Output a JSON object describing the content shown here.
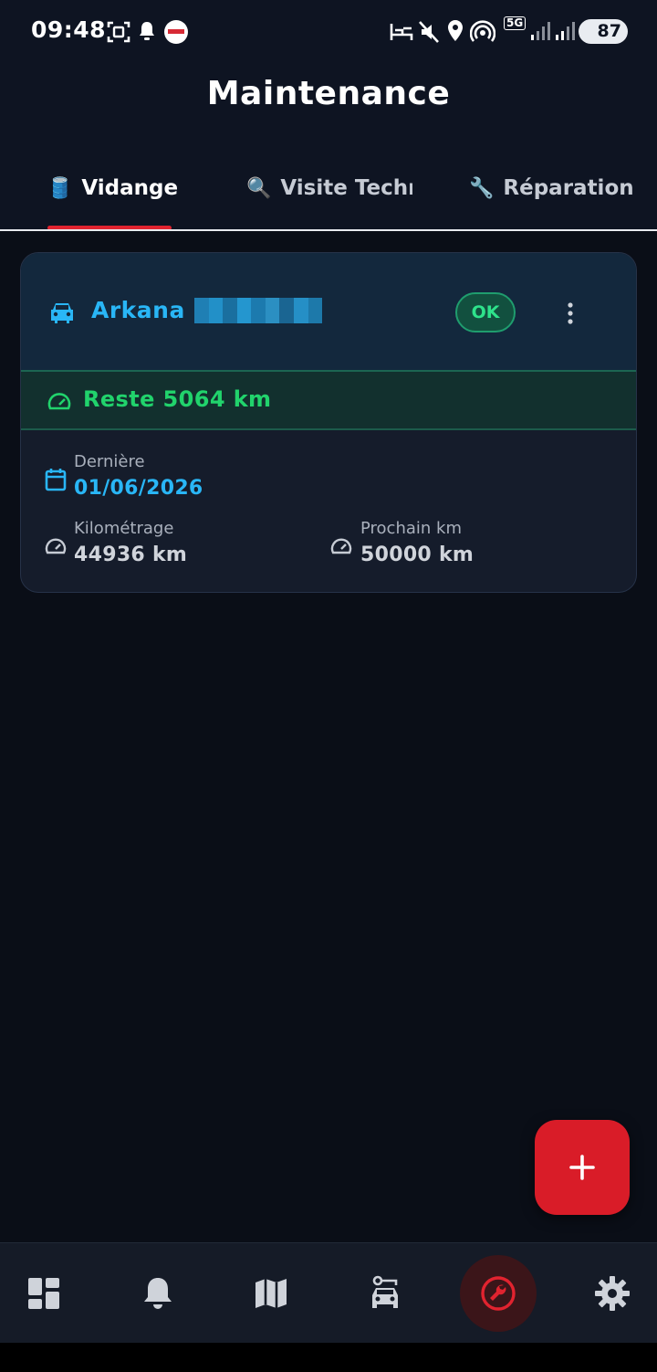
{
  "status_bar": {
    "time": "09:48",
    "battery": "87",
    "network": "5G",
    "icons": [
      "screenshot-icon",
      "bell-icon",
      "app-badge-icon",
      "sleep-icon",
      "mute-icon",
      "location-icon",
      "hotspot-icon",
      "signal-icon",
      "battery-icon"
    ]
  },
  "header": {
    "title": "Maintenance"
  },
  "tabs": [
    {
      "emoji": "🛢️",
      "label": "Vidange",
      "active": true
    },
    {
      "emoji": "🔍",
      "label": "Visite Techn",
      "active": false
    },
    {
      "emoji": "🔧",
      "label": "Réparation",
      "active": false
    }
  ],
  "card": {
    "vehicle_name": "Arkana",
    "status": "OK",
    "remaining": "Reste 5064 km",
    "last": {
      "label": "Dernière",
      "value": "01/06/2026"
    },
    "mileage": {
      "label": "Kilométrage",
      "value": "44936 km"
    },
    "next": {
      "label": "Prochain km",
      "value": "50000 km"
    }
  },
  "fab": {
    "icon": "plus-icon"
  },
  "bottom_nav": [
    {
      "name": "dashboard",
      "icon": "dashboard-icon",
      "active": false
    },
    {
      "name": "notifications",
      "icon": "bell-icon",
      "active": false
    },
    {
      "name": "map",
      "icon": "map-icon",
      "active": false
    },
    {
      "name": "vehicles",
      "icon": "car-key-icon",
      "active": false
    },
    {
      "name": "maintenance",
      "icon": "wrench-icon",
      "active": true
    },
    {
      "name": "settings",
      "icon": "gear-icon",
      "active": false
    }
  ],
  "colors": {
    "background": "#0a0e17",
    "accent_red": "#e1232f",
    "accent_blue": "#29b6f6",
    "success_green": "#21d36c"
  }
}
